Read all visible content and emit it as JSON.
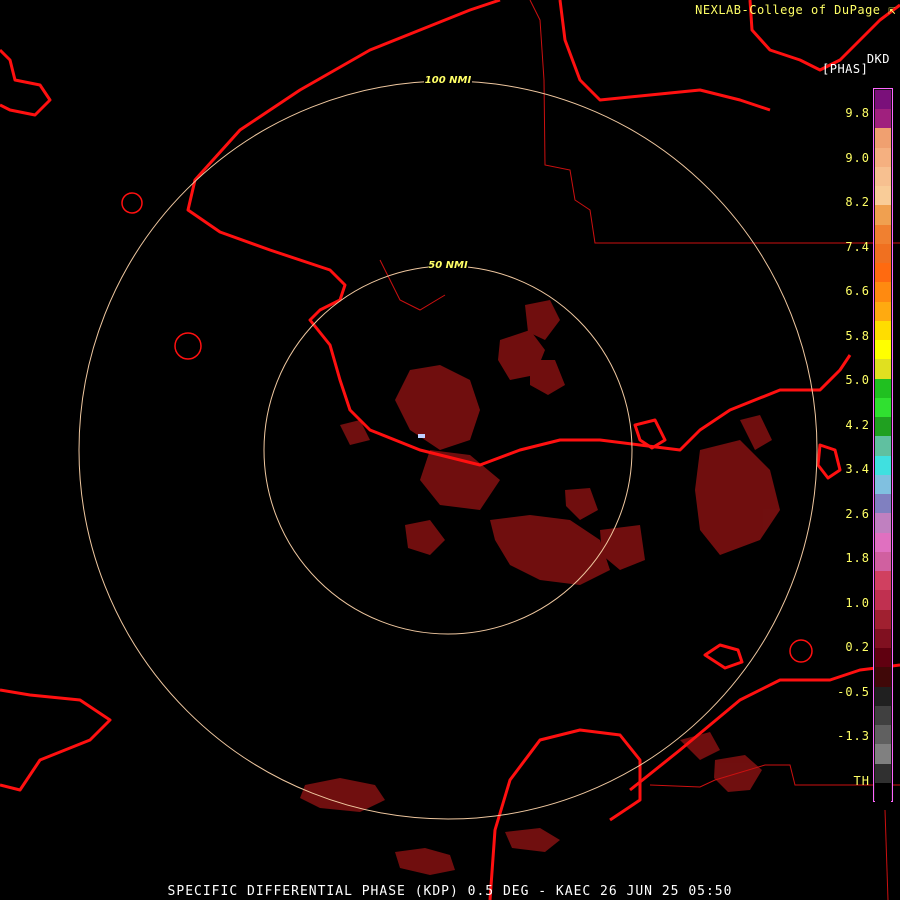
{
  "header": {
    "credit": "NEXLAB-College of DuPage",
    "credit_icon": "cursor-icon",
    "product_code": "DKD",
    "unit": "[PHAS]"
  },
  "footer": {
    "caption": "SPECIFIC DIFFERENTIAL PHASE (KDP) 0.5 DEG - KAEC 26 JUN 25 05:50"
  },
  "range_rings": [
    {
      "label": "50 NMI",
      "range_nmi": 50
    },
    {
      "label": "100 NMI",
      "range_nmi": 100
    }
  ],
  "legend": {
    "ticks": [
      "9.8",
      "9.0",
      "8.2",
      "7.4",
      "6.6",
      "5.8",
      "5.0",
      "4.2",
      "3.4",
      "2.6",
      "1.8",
      "1.0",
      "0.2",
      "-0.5",
      "-1.3",
      "TH"
    ],
    "colors": [
      "#7a107a",
      "#a0207e",
      "#f0a070",
      "#f5b080",
      "#f7c090",
      "#f9cc98",
      "#f0a050",
      "#f08030",
      "#f07020",
      "#ff6a10",
      "#ff8a10",
      "#ffaa10",
      "#ffdd00",
      "#ffff00",
      "#e0e020",
      "#20c020",
      "#30e030",
      "#20a020",
      "#60c0a0",
      "#40e0e0",
      "#80c0e0",
      "#8080c0",
      "#c080c0",
      "#e070c0",
      "#d060a0",
      "#d04060",
      "#c03050",
      "#a02030",
      "#801020",
      "#600010",
      "#400808",
      "#202020",
      "#404040",
      "#606060",
      "#808080",
      "#303030",
      "#000000"
    ]
  },
  "colors": {
    "coastline": "#ff1010",
    "border": "#cc1010",
    "range_ring": "#f0c8a0",
    "echo": "#7a1010"
  }
}
